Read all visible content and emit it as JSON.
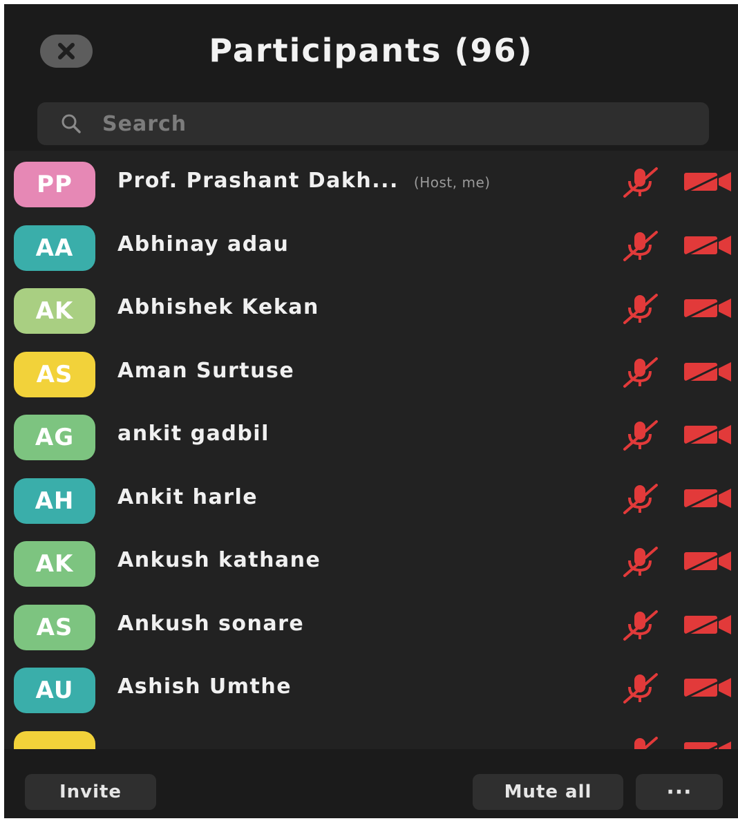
{
  "header": {
    "title": "Participants (96)"
  },
  "search": {
    "placeholder": "Search"
  },
  "participants": [
    {
      "initials": "PP",
      "name": "Prof. Prashant Dakh...",
      "role": "(Host, me)",
      "color": "#e688b5"
    },
    {
      "initials": "AA",
      "name": "Abhinay adau",
      "role": "",
      "color": "#3aaeaa"
    },
    {
      "initials": "AK",
      "name": "Abhishek Kekan",
      "role": "",
      "color": "#a9cf82"
    },
    {
      "initials": "AS",
      "name": "Aman Surtuse",
      "role": "",
      "color": "#f2d23a"
    },
    {
      "initials": "AG",
      "name": "ankit gadbil",
      "role": "",
      "color": "#7dc480"
    },
    {
      "initials": "AH",
      "name": "Ankit harle",
      "role": "",
      "color": "#3aaeaa"
    },
    {
      "initials": "AK",
      "name": "Ankush kathane",
      "role": "",
      "color": "#7dc480"
    },
    {
      "initials": "AS",
      "name": "Ankush sonare",
      "role": "",
      "color": "#7dc480"
    },
    {
      "initials": "AU",
      "name": "Ashish Umthe",
      "role": "",
      "color": "#3aaeaa"
    },
    {
      "initials": "",
      "name": "",
      "role": "",
      "color": "#f2d23a"
    }
  ],
  "status_icons": {
    "mic": "mic-muted-icon",
    "camera": "camera-off-icon",
    "muted_color": "#e23a3a"
  },
  "footer": {
    "invite_label": "Invite",
    "mute_all_label": "Mute all",
    "more_label": "···"
  }
}
